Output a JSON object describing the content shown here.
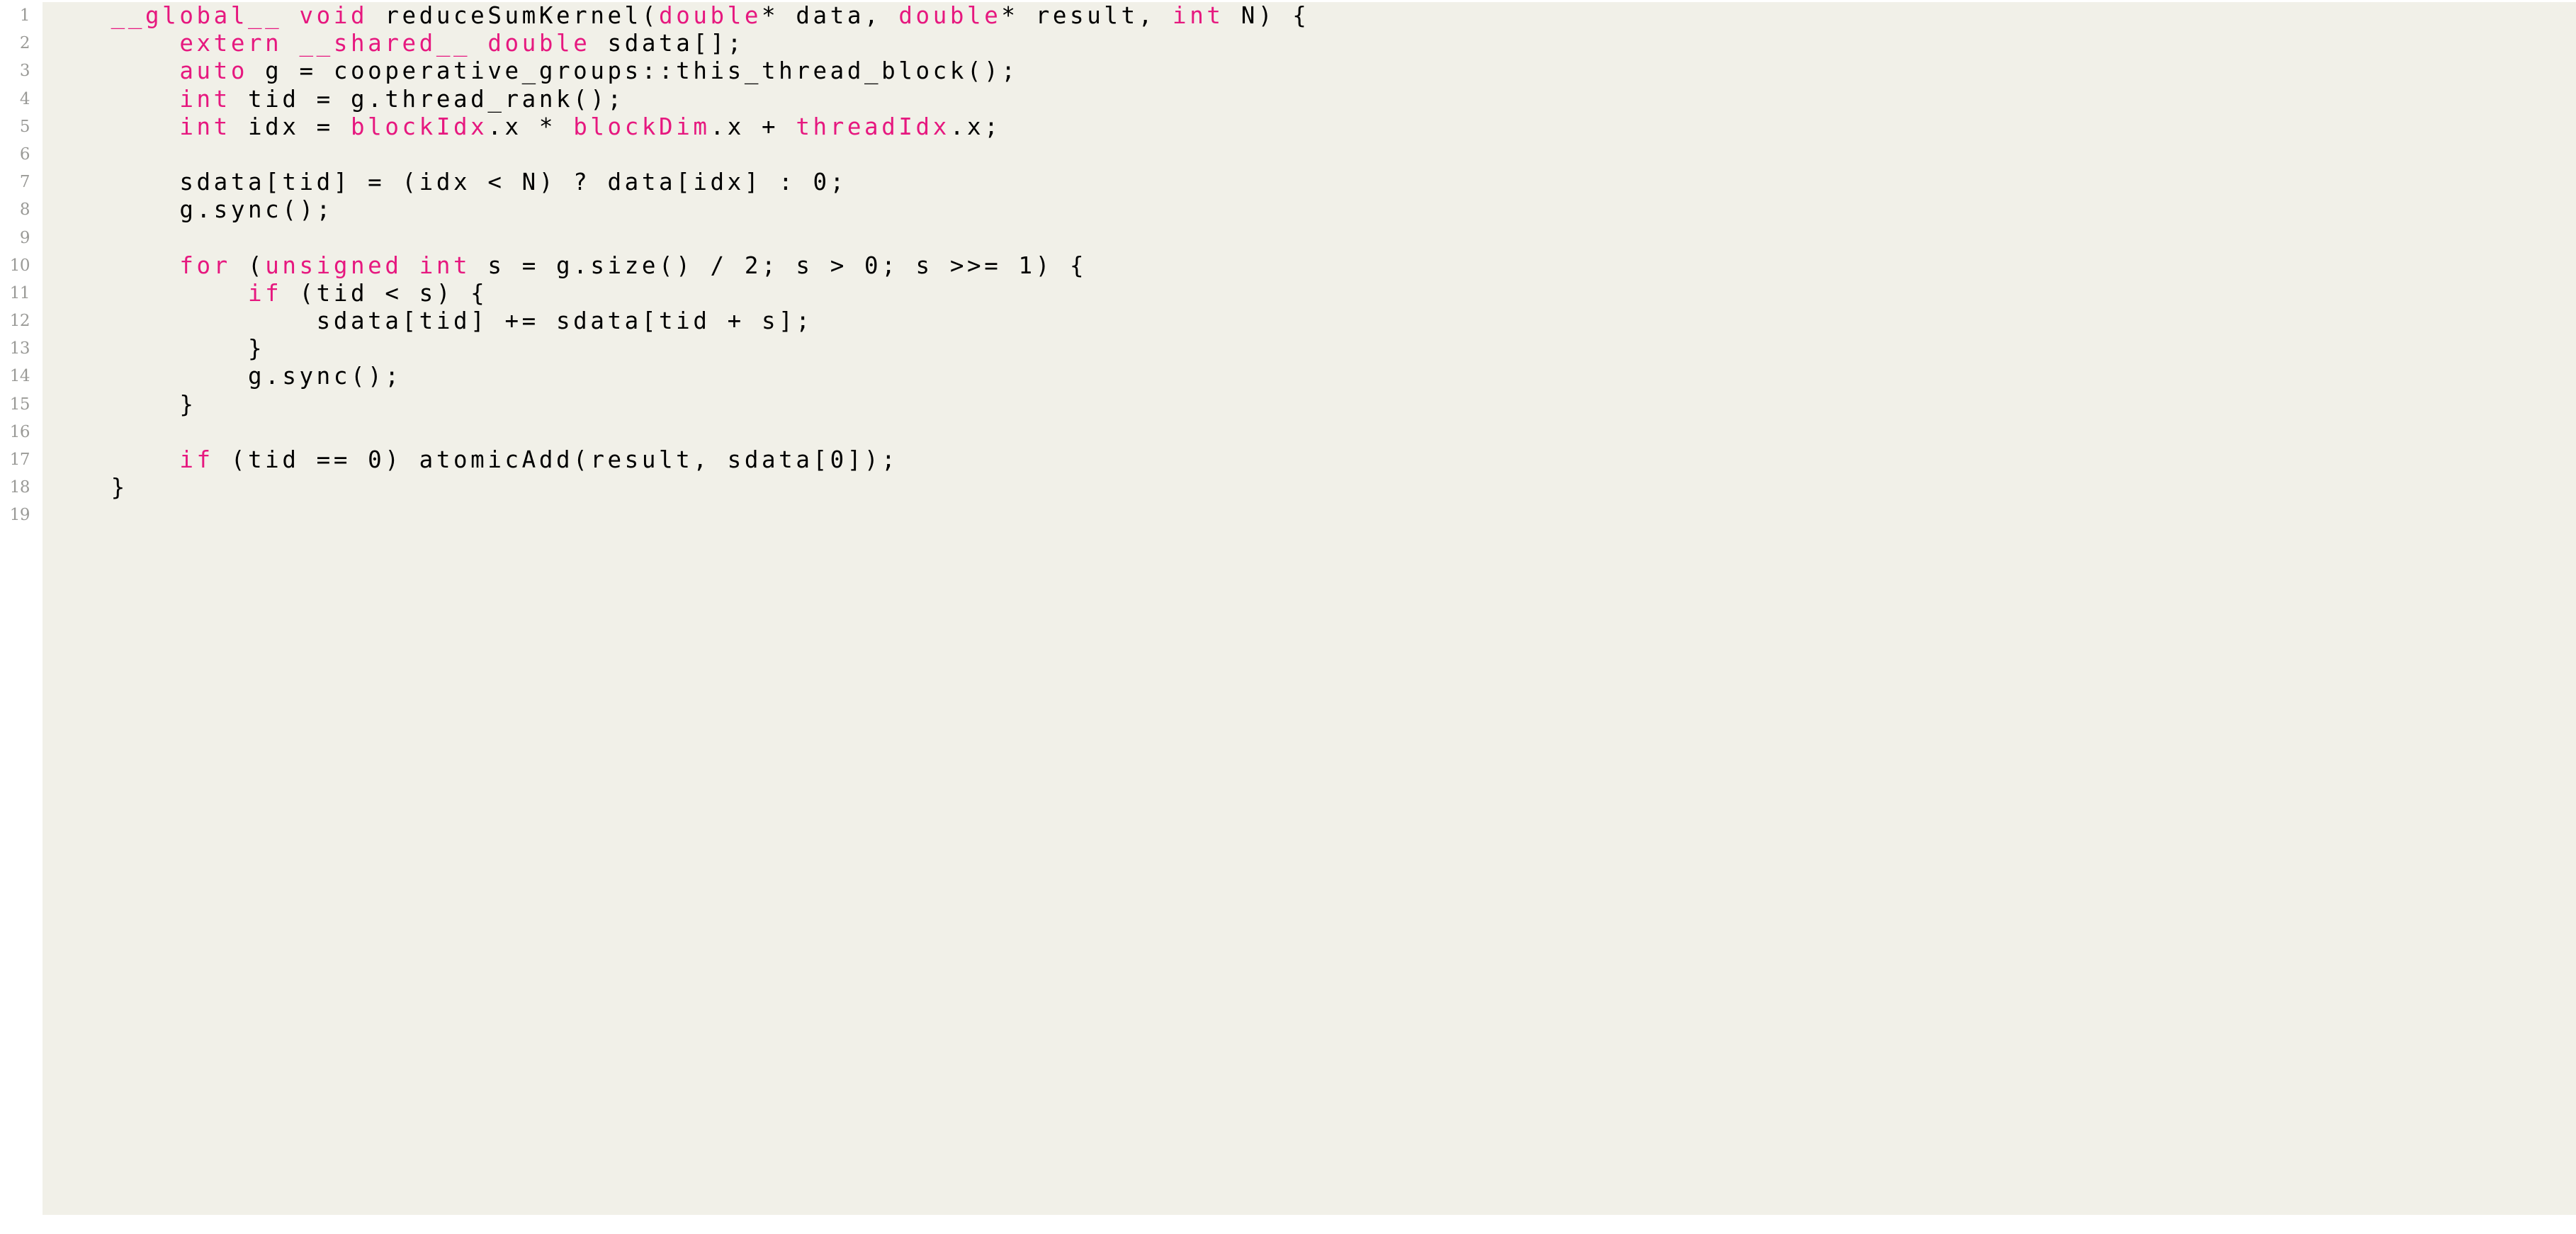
{
  "listing": {
    "language": "CUDA C++",
    "background_color": "#f1f0e8",
    "page_background_color": "#ffffff",
    "keyword_color": "#e6187f",
    "text_color": "#000000",
    "line_number_color": "#9a9a97",
    "first_line_number": 1,
    "last_line_number": 19,
    "line_numbers": [
      "1",
      "2",
      "3",
      "4",
      "5",
      "6",
      "7",
      "8",
      "9",
      "10",
      "11",
      "12",
      "13",
      "14",
      "15",
      "16",
      "17",
      "18",
      "19"
    ],
    "lines": [
      {
        "number": "1",
        "text": "    __global__ void reduceSumKernel(double* data, double* result, int N) {",
        "tokens": [
          {
            "t": "    ",
            "c": "plain"
          },
          {
            "t": "__global__",
            "c": "keyword"
          },
          {
            "t": " ",
            "c": "plain"
          },
          {
            "t": "void",
            "c": "keyword"
          },
          {
            "t": " reduceSumKernel(",
            "c": "plain"
          },
          {
            "t": "double",
            "c": "keyword"
          },
          {
            "t": "* data, ",
            "c": "plain"
          },
          {
            "t": "double",
            "c": "keyword"
          },
          {
            "t": "* result, ",
            "c": "plain"
          },
          {
            "t": "int",
            "c": "keyword"
          },
          {
            "t": " N) {",
            "c": "plain"
          }
        ]
      },
      {
        "number": "2",
        "text": "        extern __shared__ double sdata[];",
        "tokens": [
          {
            "t": "        ",
            "c": "plain"
          },
          {
            "t": "extern",
            "c": "keyword"
          },
          {
            "t": " ",
            "c": "plain"
          },
          {
            "t": "__shared__",
            "c": "keyword"
          },
          {
            "t": " ",
            "c": "plain"
          },
          {
            "t": "double",
            "c": "keyword"
          },
          {
            "t": " sdata[];",
            "c": "plain"
          }
        ]
      },
      {
        "number": "3",
        "text": "        auto g = cooperative_groups::this_thread_block();",
        "tokens": [
          {
            "t": "        ",
            "c": "plain"
          },
          {
            "t": "auto",
            "c": "keyword"
          },
          {
            "t": " g = cooperative_groups::this_thread_block();",
            "c": "plain"
          }
        ]
      },
      {
        "number": "4",
        "text": "        int tid = g.thread_rank();",
        "tokens": [
          {
            "t": "        ",
            "c": "plain"
          },
          {
            "t": "int",
            "c": "keyword"
          },
          {
            "t": " tid = g.thread_rank();",
            "c": "plain"
          }
        ]
      },
      {
        "number": "5",
        "text": "        int idx = blockIdx.x * blockDim.x + threadIdx.x;",
        "tokens": [
          {
            "t": "        ",
            "c": "plain"
          },
          {
            "t": "int",
            "c": "keyword"
          },
          {
            "t": " idx = ",
            "c": "plain"
          },
          {
            "t": "blockIdx",
            "c": "keyword"
          },
          {
            "t": ".x * ",
            "c": "plain"
          },
          {
            "t": "blockDim",
            "c": "keyword"
          },
          {
            "t": ".x + ",
            "c": "plain"
          },
          {
            "t": "threadIdx",
            "c": "keyword"
          },
          {
            "t": ".x;",
            "c": "plain"
          }
        ]
      },
      {
        "number": "6",
        "text": "",
        "tokens": []
      },
      {
        "number": "7",
        "text": "        sdata[tid] = (idx < N) ? data[idx] : 0;",
        "tokens": [
          {
            "t": "        sdata[tid] = (idx < N) ? data[idx] : 0;",
            "c": "plain"
          }
        ]
      },
      {
        "number": "8",
        "text": "        g.sync();",
        "tokens": [
          {
            "t": "        g.sync();",
            "c": "plain"
          }
        ]
      },
      {
        "number": "9",
        "text": "",
        "tokens": []
      },
      {
        "number": "10",
        "text": "        for (unsigned int s = g.size() / 2; s > 0; s >>= 1) {",
        "tokens": [
          {
            "t": "        ",
            "c": "plain"
          },
          {
            "t": "for",
            "c": "keyword"
          },
          {
            "t": " (",
            "c": "plain"
          },
          {
            "t": "unsigned",
            "c": "keyword"
          },
          {
            "t": " ",
            "c": "plain"
          },
          {
            "t": "int",
            "c": "keyword"
          },
          {
            "t": " s = g.size() / 2; s > 0; s >>= 1) {",
            "c": "plain"
          }
        ]
      },
      {
        "number": "11",
        "text": "            if (tid < s) {",
        "tokens": [
          {
            "t": "            ",
            "c": "plain"
          },
          {
            "t": "if",
            "c": "keyword"
          },
          {
            "t": " (tid < s) {",
            "c": "plain"
          }
        ]
      },
      {
        "number": "12",
        "text": "                sdata[tid] += sdata[tid + s];",
        "tokens": [
          {
            "t": "                sdata[tid] += sdata[tid + s];",
            "c": "plain"
          }
        ]
      },
      {
        "number": "13",
        "text": "            }",
        "tokens": [
          {
            "t": "            }",
            "c": "plain"
          }
        ]
      },
      {
        "number": "14",
        "text": "            g.sync();",
        "tokens": [
          {
            "t": "            g.sync();",
            "c": "plain"
          }
        ]
      },
      {
        "number": "15",
        "text": "        }",
        "tokens": [
          {
            "t": "        }",
            "c": "plain"
          }
        ]
      },
      {
        "number": "16",
        "text": "",
        "tokens": []
      },
      {
        "number": "17",
        "text": "        if (tid == 0) atomicAdd(result, sdata[0]);",
        "tokens": [
          {
            "t": "        ",
            "c": "plain"
          },
          {
            "t": "if",
            "c": "keyword"
          },
          {
            "t": " (tid == 0) atomicAdd(result, sdata[0]);",
            "c": "plain"
          }
        ]
      },
      {
        "number": "18",
        "text": "    }",
        "tokens": [
          {
            "t": "    }",
            "c": "plain"
          }
        ]
      },
      {
        "number": "19",
        "text": "",
        "tokens": []
      }
    ]
  }
}
